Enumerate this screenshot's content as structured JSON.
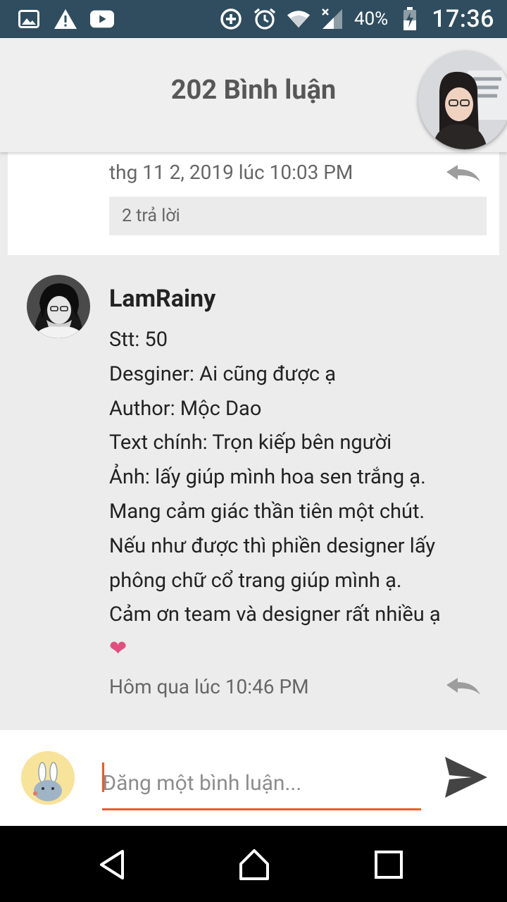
{
  "status_bar": {
    "battery": "40%",
    "time": "17:36"
  },
  "header": {
    "title": "202 Bình luận"
  },
  "previous_comment": {
    "timestamp": "thg 11 2, 2019 lúc 10:03 PM",
    "replies": "2 trả lời"
  },
  "comment": {
    "author": "LamRainy",
    "lines": [
      "Stt: 50",
      "Desginer: Ai cũng được ạ",
      "Author: Mộc Dao",
      "Text chính: Trọn kiếp bên người",
      "Ảnh:  lấy giúp mình hoa sen trắng ạ.",
      "Mang cảm giác thần tiên một chút.",
      "Nếu như được thì phiền designer lấy",
      "phông chữ cổ trang giúp mình ạ.",
      "Cảm ơn team và designer rất nhiều ạ"
    ],
    "heart": "❤",
    "timestamp": "Hôm qua lúc 10:46 PM"
  },
  "composer": {
    "placeholder": "Đăng một bình luận..."
  },
  "colors": {
    "status_bar": "#2f4d5e",
    "accent": "#ef5a24",
    "heart": "#e24f7e"
  }
}
